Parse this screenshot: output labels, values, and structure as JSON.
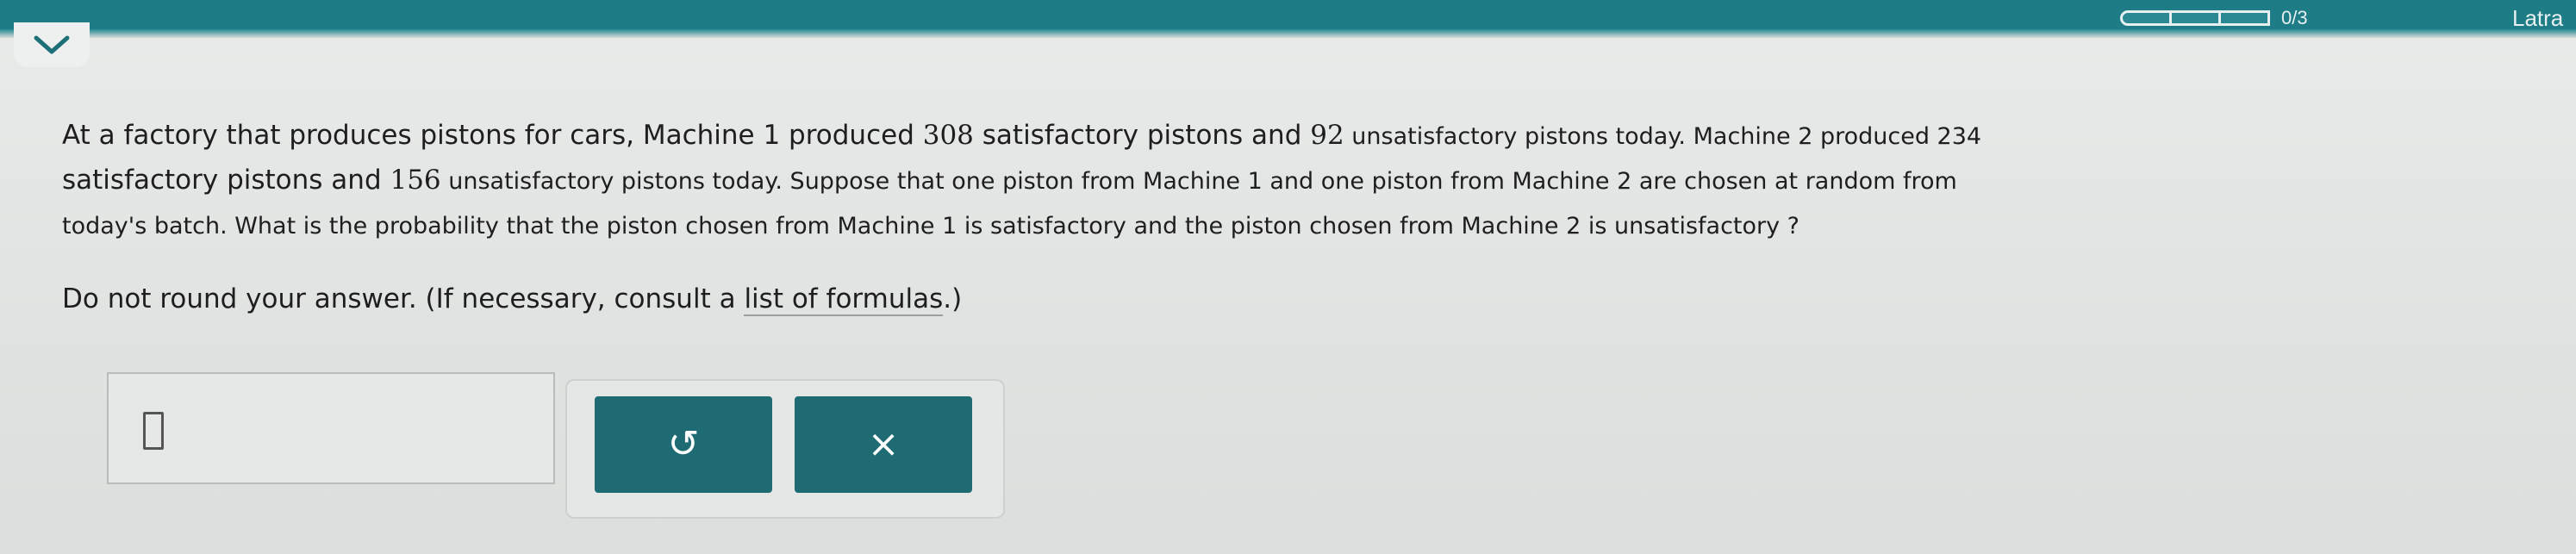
{
  "header": {
    "progress_label": "0/3",
    "side_link_label": "Latra",
    "progress_segments": 3
  },
  "question": {
    "lines": [
      [
        {
          "t": "At a factory that produces pistons for cars, Machine 1 produced ",
          "n": false
        },
        {
          "t": "308",
          "n": true
        },
        {
          "t": " satisfactory pistons and ",
          "n": false
        },
        {
          "t": "92",
          "n": true
        },
        {
          "t": " unsatisfactory pistons today. Machine 2 produced 234",
          "n": false
        }
      ],
      [
        {
          "t": "satisfactory pistons and ",
          "n": false
        },
        {
          "t": "156",
          "n": true
        },
        {
          "t": " unsatisfactory pistons today. Suppose that one piston from Machine 1 and one piston from Machine 2 are chosen at random from",
          "n": false
        }
      ],
      [
        {
          "t": "today's batch. What is the probability that the piston chosen from Machine 1 is satisfactory and the piston chosen from Machine 2 is unsatisfactory ?",
          "n": false
        }
      ]
    ],
    "instruction_prefix": "Do not round your answer. (If necessary, consult a ",
    "instruction_link": "list of formulas",
    "instruction_suffix": ".)"
  },
  "answer": {
    "value": ""
  },
  "buttons": {
    "undo_symbol": "↺",
    "clear_symbol": "×"
  },
  "colors": {
    "topbar": "#1d7c86",
    "button": "#1f6b73",
    "background": "#e2e4e3"
  }
}
